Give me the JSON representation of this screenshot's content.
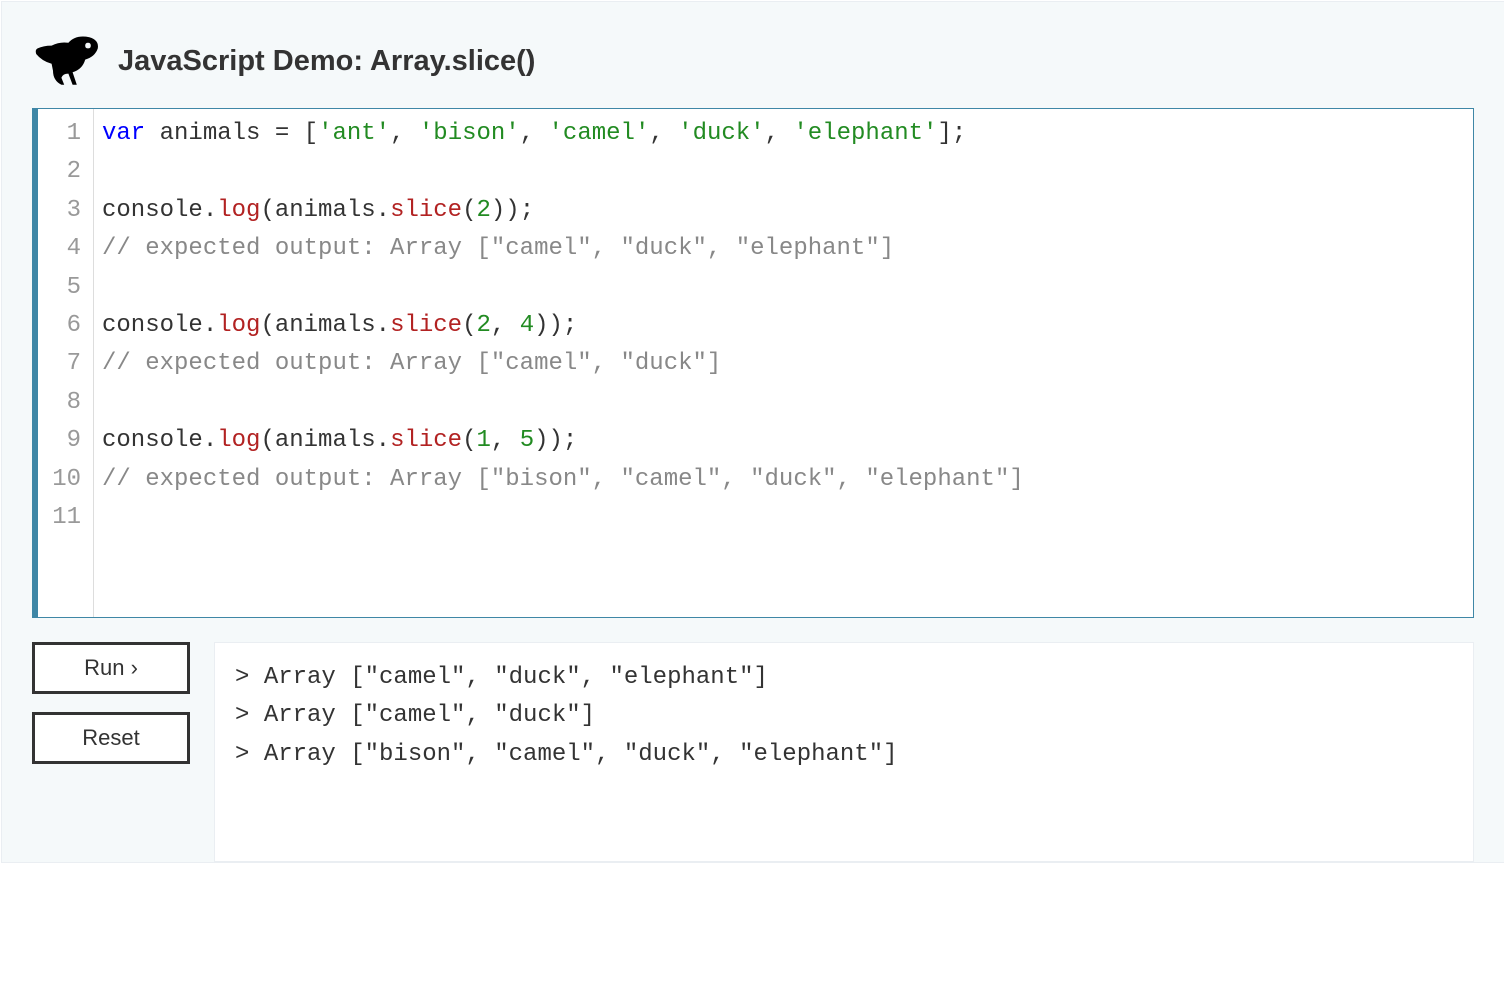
{
  "title": "JavaScript Demo: Array.slice()",
  "code": {
    "lines": [
      {
        "n": "1",
        "tokens": [
          {
            "t": "var",
            "c": "tok-kw"
          },
          {
            "t": " "
          },
          {
            "t": "animals",
            "c": "tok-def"
          },
          {
            "t": " = ["
          },
          {
            "t": "'ant'",
            "c": "tok-str"
          },
          {
            "t": ", "
          },
          {
            "t": "'bison'",
            "c": "tok-str"
          },
          {
            "t": ", "
          },
          {
            "t": "'camel'",
            "c": "tok-str"
          },
          {
            "t": ", "
          },
          {
            "t": "'duck'",
            "c": "tok-str"
          },
          {
            "t": ", "
          },
          {
            "t": "'elephant'",
            "c": "tok-str"
          },
          {
            "t": "];"
          }
        ]
      },
      {
        "n": "2",
        "tokens": []
      },
      {
        "n": "3",
        "tokens": [
          {
            "t": "console."
          },
          {
            "t": "log",
            "c": "tok-prop"
          },
          {
            "t": "(animals."
          },
          {
            "t": "slice",
            "c": "tok-prop"
          },
          {
            "t": "("
          },
          {
            "t": "2",
            "c": "tok-num"
          },
          {
            "t": "));"
          }
        ]
      },
      {
        "n": "4",
        "tokens": [
          {
            "t": "// expected output: Array [\"camel\", \"duck\", \"elephant\"]",
            "c": "tok-com"
          }
        ]
      },
      {
        "n": "5",
        "tokens": []
      },
      {
        "n": "6",
        "tokens": [
          {
            "t": "console."
          },
          {
            "t": "log",
            "c": "tok-prop"
          },
          {
            "t": "(animals."
          },
          {
            "t": "slice",
            "c": "tok-prop"
          },
          {
            "t": "("
          },
          {
            "t": "2",
            "c": "tok-num"
          },
          {
            "t": ", "
          },
          {
            "t": "4",
            "c": "tok-num"
          },
          {
            "t": "));"
          }
        ]
      },
      {
        "n": "7",
        "tokens": [
          {
            "t": "// expected output: Array [\"camel\", \"duck\"]",
            "c": "tok-com"
          }
        ]
      },
      {
        "n": "8",
        "tokens": []
      },
      {
        "n": "9",
        "tokens": [
          {
            "t": "console."
          },
          {
            "t": "log",
            "c": "tok-prop"
          },
          {
            "t": "(animals."
          },
          {
            "t": "slice",
            "c": "tok-prop"
          },
          {
            "t": "("
          },
          {
            "t": "1",
            "c": "tok-num"
          },
          {
            "t": ", "
          },
          {
            "t": "5",
            "c": "tok-num"
          },
          {
            "t": "));"
          }
        ]
      },
      {
        "n": "10",
        "tokens": [
          {
            "t": "// expected output: Array [\"bison\", \"camel\", \"duck\", \"elephant\"]",
            "c": "tok-com"
          }
        ]
      },
      {
        "n": "11",
        "tokens": []
      }
    ]
  },
  "buttons": {
    "run": "Run ›",
    "reset": "Reset"
  },
  "console": {
    "lines": [
      "Array [\"camel\", \"duck\", \"elephant\"]",
      "Array [\"camel\", \"duck\"]",
      "Array [\"bison\", \"camel\", \"duck\", \"elephant\"]"
    ]
  }
}
